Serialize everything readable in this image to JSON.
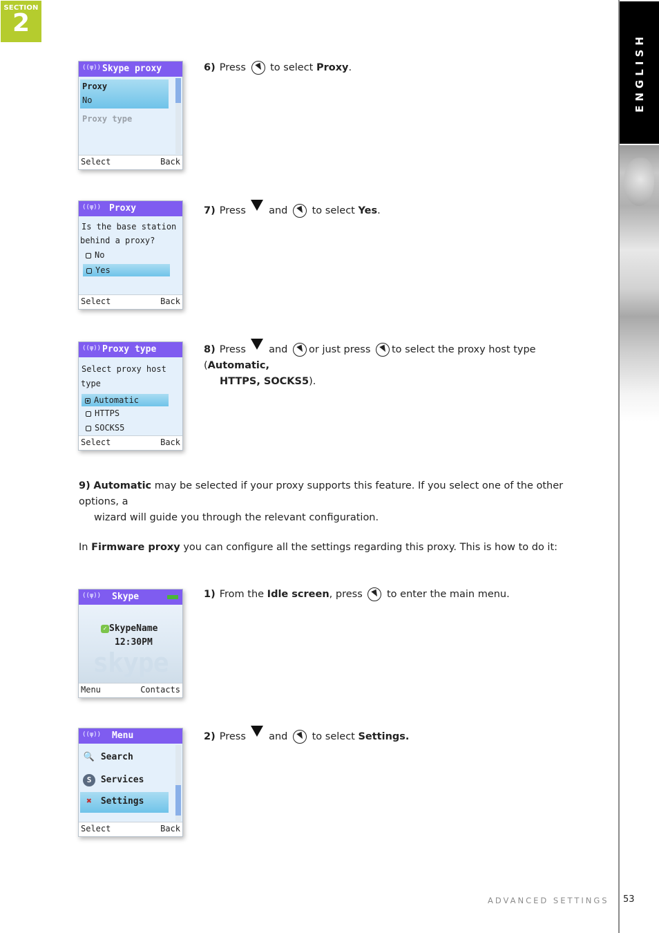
{
  "section_badge": {
    "label": "SECTION",
    "number": "2"
  },
  "language_tab": "ENGLISH",
  "screens": [
    {
      "title": "Skype proxy",
      "items": [
        {
          "label": "Proxy",
          "value": "No",
          "selected": true
        },
        {
          "label": "Proxy type"
        }
      ],
      "soft_left": "Select",
      "soft_right": "Back"
    },
    {
      "title": "Proxy",
      "prompt_line1": "Is the base station",
      "prompt_line2": "behind a proxy?",
      "options": [
        "No",
        "Yes"
      ],
      "selected_option": "Yes",
      "soft_left": "Select",
      "soft_right": "Back"
    },
    {
      "title": "Proxy type",
      "prompt_line1": "Select proxy host",
      "prompt_line2": "type",
      "options": [
        "Automatic",
        "HTTPS",
        "SOCKS5"
      ],
      "selected_option": "Automatic",
      "soft_left": "Select",
      "soft_right": "Back"
    },
    {
      "title": "Skype",
      "user": "SkypeName",
      "time": "12:30PM",
      "watermark": "skype",
      "soft_left": "Menu",
      "soft_right": "Contacts"
    },
    {
      "title": "Menu",
      "items": [
        {
          "label": "Search",
          "icon": "magnifier"
        },
        {
          "label": "Services",
          "icon": "skype-s"
        },
        {
          "label": "Settings",
          "icon": "tools",
          "selected": true
        }
      ],
      "soft_left": "Select",
      "soft_right": "Back"
    }
  ],
  "steps": {
    "s6": {
      "num": "6)",
      "t1": "Press",
      "t2": "to select",
      "bold": "Proxy",
      "end": "."
    },
    "s7": {
      "num": "7)",
      "t1": "Press",
      "t2": "and",
      "t3": "to select",
      "bold": "Yes",
      "end": "."
    },
    "s8": {
      "num": "8)",
      "t1": "Press",
      "t2": "and",
      "t3": "or just press",
      "t4": "to select the proxy host type (",
      "bold1": "Automatic,",
      "bold2": "HTTPS, SOCKS5",
      "end": ")."
    },
    "s9": {
      "num": "9)",
      "bold": "Automatic",
      "t1": " may be selected if your proxy supports this feature. If you select one of the other options, a",
      "t2": "wizard will guide you through the relevant configuration."
    },
    "intro": {
      "t1": "In ",
      "bold": "Firmware proxy",
      "t2": " you can configure all the settings regarding this proxy. This is how to do it:"
    },
    "f1": {
      "num": "1)",
      "t1": "From the",
      "bold": "Idle screen",
      "t2": ", press",
      "t3": "to enter the main menu."
    },
    "f2": {
      "num": "2)",
      "t1": "Press",
      "t2": "and",
      "t3": "to select",
      "bold": "Settings."
    }
  },
  "footer": {
    "title": "ADVANCED SETTINGS",
    "page": "53"
  },
  "colors": {
    "section_green": "#b5cc2e",
    "phone_header": "#7f5cf0",
    "selection": "#6fc3e9"
  }
}
